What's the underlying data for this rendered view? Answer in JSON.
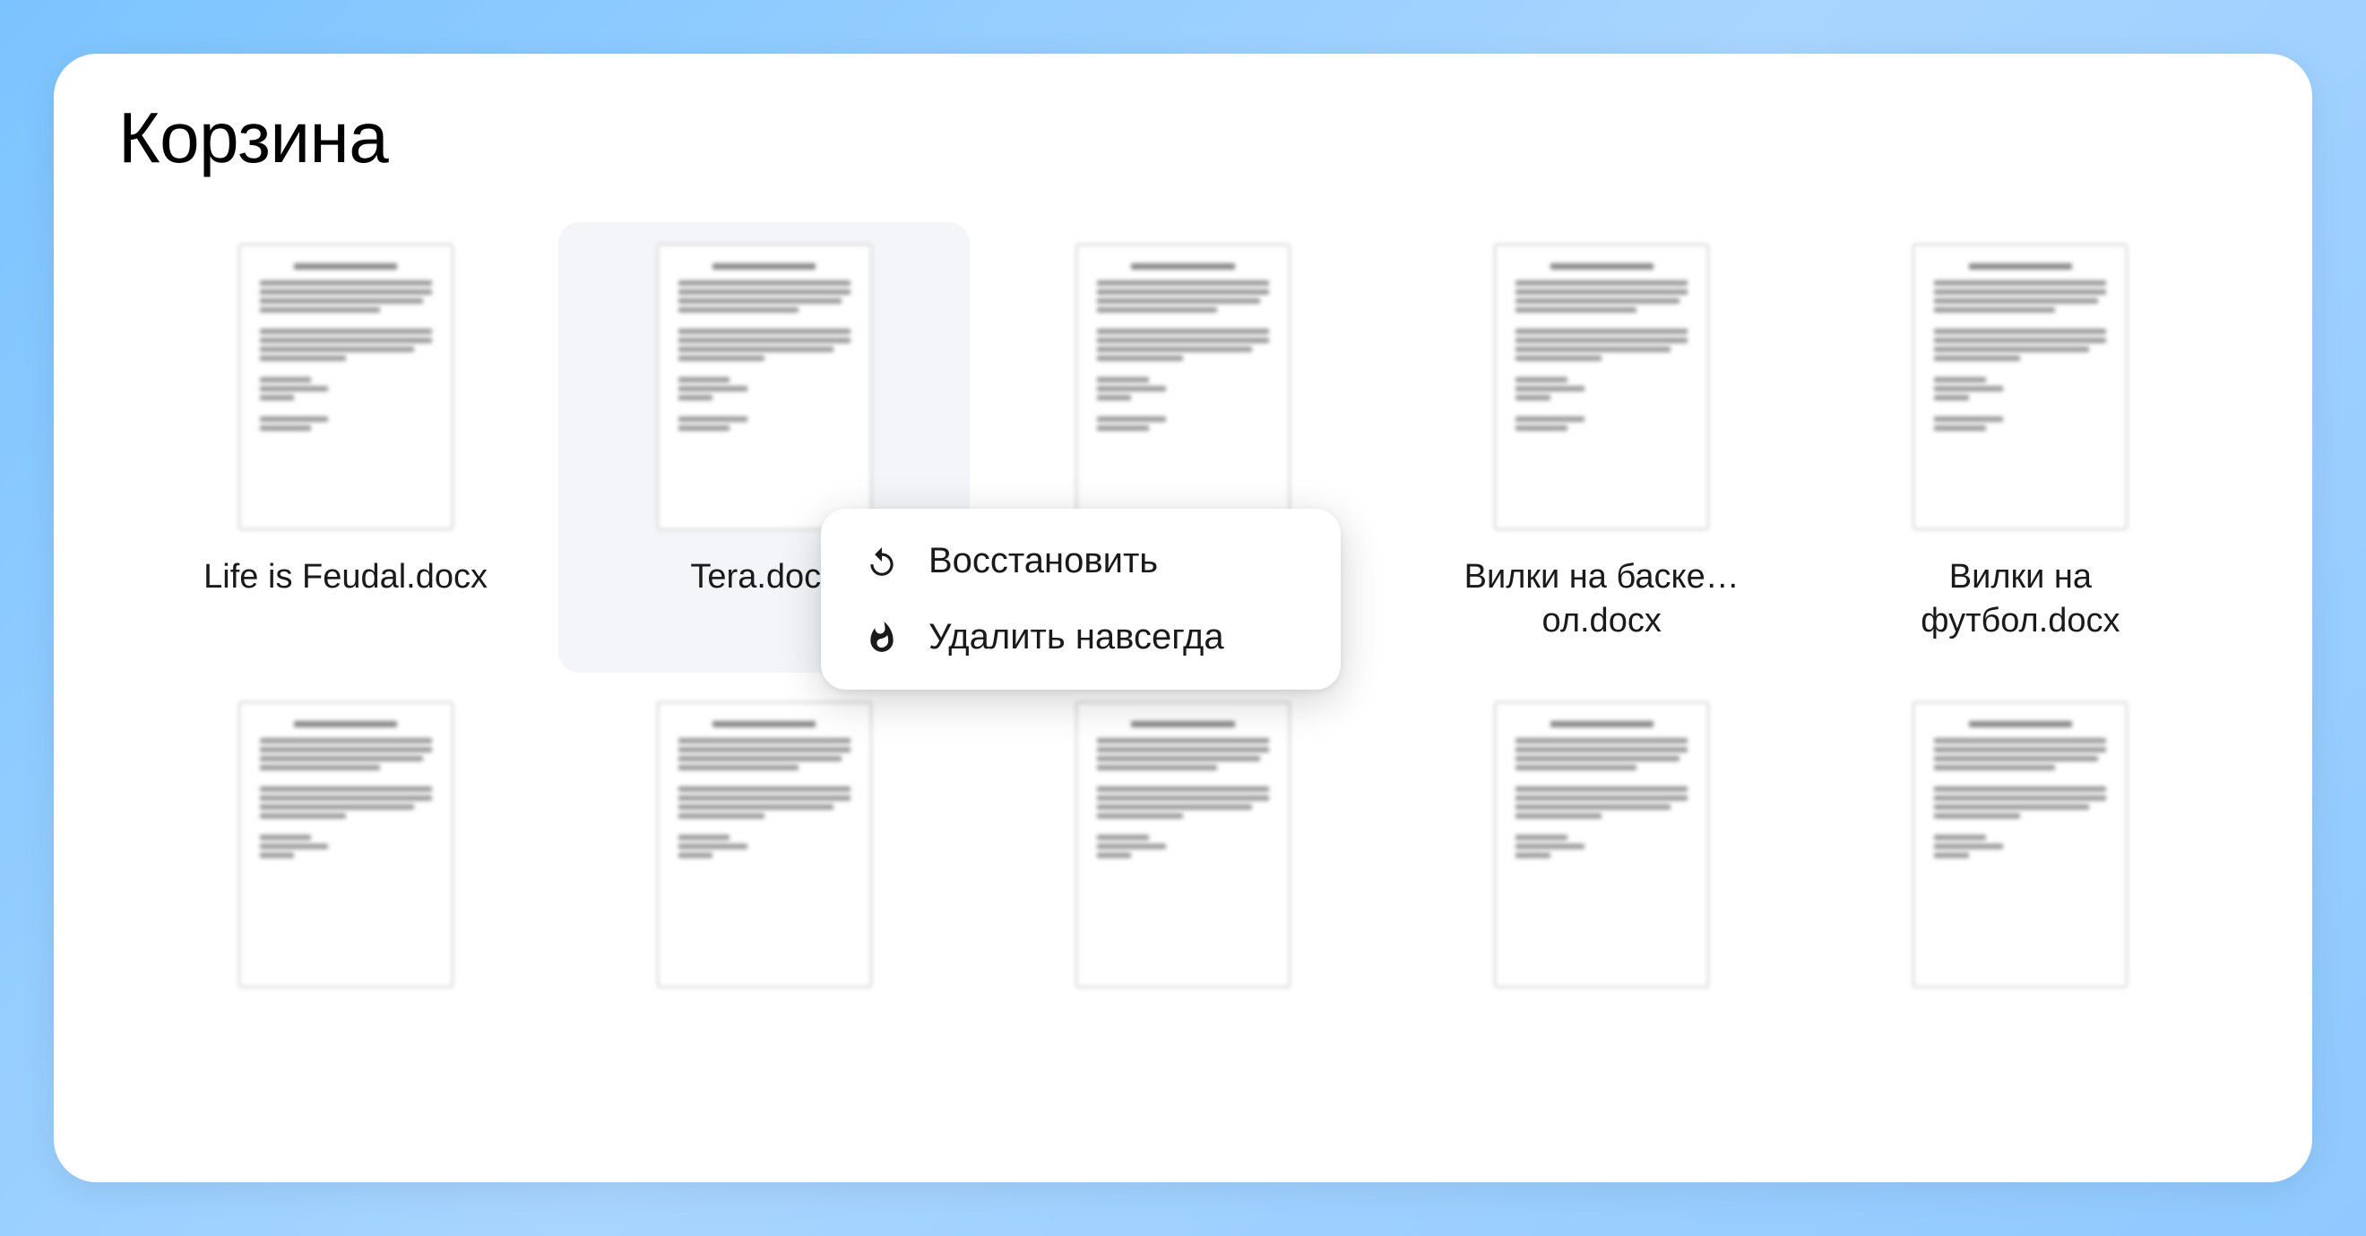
{
  "page": {
    "title": "Корзина"
  },
  "files": [
    {
      "name": "Life is Feudal.docx"
    },
    {
      "name": "Tera.docx"
    },
    {
      "name": ""
    },
    {
      "name": "Вилки на баске…ол.docx"
    },
    {
      "name": "Вилки на футбол.docx"
    },
    {
      "name": ""
    },
    {
      "name": ""
    },
    {
      "name": ""
    },
    {
      "name": ""
    },
    {
      "name": ""
    }
  ],
  "context_menu": {
    "restore": "Восстановить",
    "delete_forever": "Удалить навсегда"
  }
}
